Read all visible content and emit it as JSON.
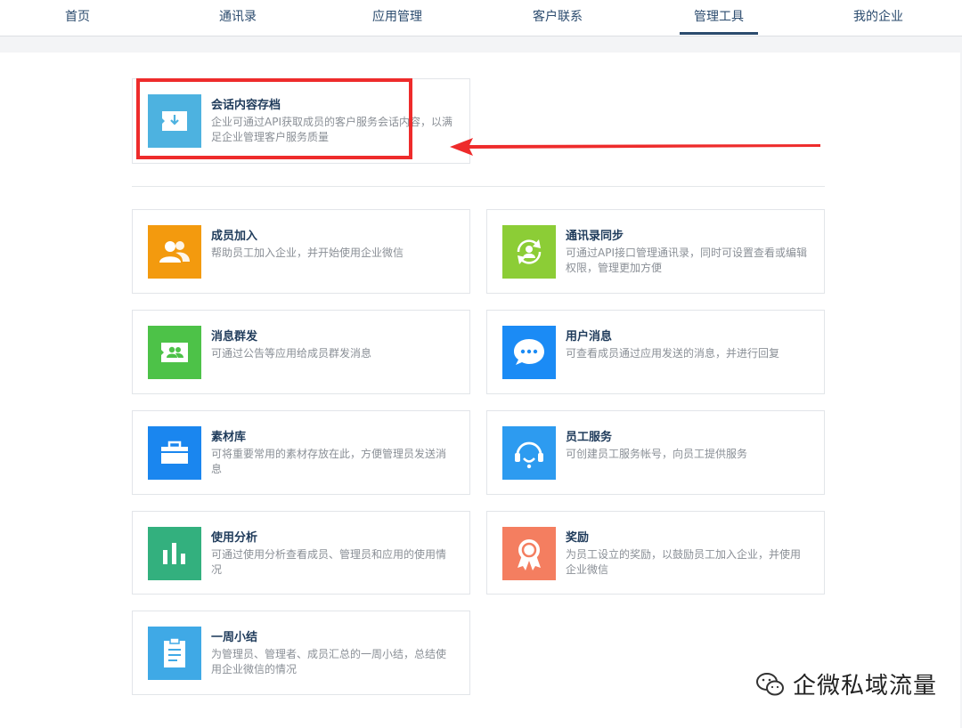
{
  "nav": {
    "tabs": [
      "首页",
      "通讯录",
      "应用管理",
      "客户联系",
      "管理工具",
      "我的企业"
    ],
    "active": "管理工具"
  },
  "featured": {
    "title": "会话内容存档",
    "desc": "企业可通过API获取成员的客户服务会话内容，以满足企业管理客户服务质量",
    "color": "#4db2e0"
  },
  "tools": [
    {
      "title": "成员加入",
      "desc": "帮助员工加入企业，并开始使用企业微信",
      "icon": "members-icon",
      "color": "#f39a0e"
    },
    {
      "title": "通讯录同步",
      "desc": "可通过API接口管理通讯录，同时可设置查看或编辑权限，管理更加方便",
      "icon": "sync-icon",
      "color": "#8ccd36"
    },
    {
      "title": "消息群发",
      "desc": "可通过公告等应用给成员群发消息",
      "icon": "broadcast-icon",
      "color": "#4dc248"
    },
    {
      "title": "用户消息",
      "desc": "可查看成员通过应用发送的消息，并进行回复",
      "icon": "chat-bubble-icon",
      "color": "#1b8bf5"
    },
    {
      "title": "素材库",
      "desc": "可将重要常用的素材存放在此，方便管理员发送消息",
      "icon": "briefcase-icon",
      "color": "#1a86ef"
    },
    {
      "title": "员工服务",
      "desc": "可创建员工服务帐号，向员工提供服务",
      "icon": "headset-icon",
      "color": "#2d9bf0"
    },
    {
      "title": "使用分析",
      "desc": "可通过使用分析查看成员、管理员和应用的使用情况",
      "icon": "bar-chart-icon",
      "color": "#33b07e"
    },
    {
      "title": "奖励",
      "desc": "为员工设立的奖励，以鼓励员工加入企业，并使用企业微信",
      "icon": "award-icon",
      "color": "#f47e60"
    },
    {
      "title": "一周小结",
      "desc": "为管理员、管理者、成员汇总的一周小结，总结使用企业微信的情况",
      "icon": "clipboard-icon",
      "color": "#3fa9e6"
    }
  ],
  "watermark_brand": "企微私域流量",
  "highlight_color": "#ee2b2b"
}
